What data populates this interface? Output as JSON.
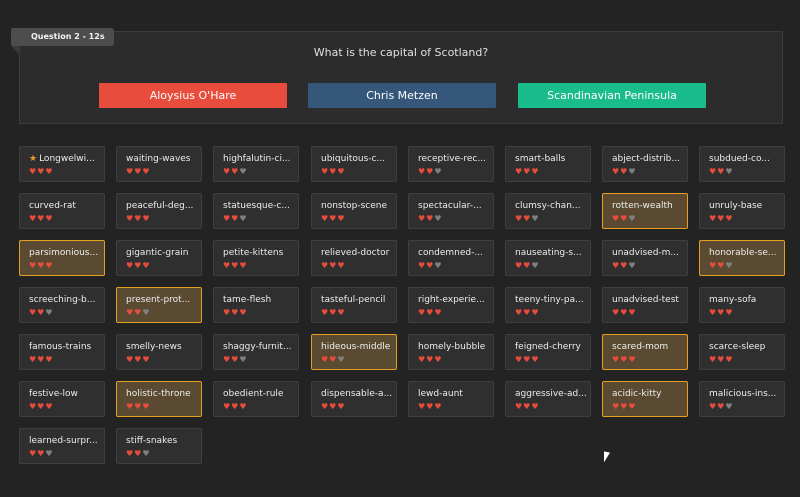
{
  "question": {
    "tag": "Question 2 - 12s",
    "text": "What is the capital of Scotland?",
    "answers": [
      "Aloysius O'Hare",
      "Chris Metzen",
      "Scandinavian Peninsula"
    ]
  },
  "colors": {
    "heart_full": "#e74c3c",
    "heart_empty": "#808080",
    "highlight": "#e5a021"
  },
  "players": [
    {
      "name": "Longwelwi...",
      "hearts": 3,
      "highlight": false,
      "star": true
    },
    {
      "name": "waiting-waves",
      "hearts": 3,
      "highlight": false
    },
    {
      "name": "highfalutin-ci...",
      "hearts": 2,
      "highlight": false
    },
    {
      "name": "ubiquitous-c...",
      "hearts": 3,
      "highlight": false
    },
    {
      "name": "receptive-rec...",
      "hearts": 2,
      "highlight": false
    },
    {
      "name": "smart-balls",
      "hearts": 3,
      "highlight": false
    },
    {
      "name": "abject-distrib...",
      "hearts": 2,
      "highlight": false
    },
    {
      "name": "subdued-co...",
      "hearts": 2,
      "highlight": false
    },
    {
      "name": "curved-rat",
      "hearts": 3,
      "highlight": false
    },
    {
      "name": "peaceful-deg...",
      "hearts": 3,
      "highlight": false
    },
    {
      "name": "statuesque-c...",
      "hearts": 2,
      "highlight": false
    },
    {
      "name": "nonstop-scene",
      "hearts": 3,
      "highlight": false
    },
    {
      "name": "spectacular-...",
      "hearts": 2,
      "highlight": false
    },
    {
      "name": "clumsy-chan...",
      "hearts": 2,
      "highlight": false
    },
    {
      "name": "rotten-wealth",
      "hearts": 2,
      "highlight": true
    },
    {
      "name": "unruly-base",
      "hearts": 3,
      "highlight": false
    },
    {
      "name": "parsimonious...",
      "hearts": 3,
      "highlight": true
    },
    {
      "name": "gigantic-grain",
      "hearts": 3,
      "highlight": false
    },
    {
      "name": "petite-kittens",
      "hearts": 3,
      "highlight": false
    },
    {
      "name": "relieved-doctor",
      "hearts": 3,
      "highlight": false
    },
    {
      "name": "condemned-...",
      "hearts": 2,
      "highlight": false
    },
    {
      "name": "nauseating-s...",
      "hearts": 2,
      "highlight": false
    },
    {
      "name": "unadvised-m...",
      "hearts": 2,
      "highlight": false
    },
    {
      "name": "honorable-se...",
      "hearts": 2,
      "highlight": true
    },
    {
      "name": "screeching-b...",
      "hearts": 2,
      "highlight": false
    },
    {
      "name": "present-prot...",
      "hearts": 2,
      "highlight": true
    },
    {
      "name": "tame-flesh",
      "hearts": 3,
      "highlight": false
    },
    {
      "name": "tasteful-pencil",
      "hearts": 3,
      "highlight": false
    },
    {
      "name": "right-experie...",
      "hearts": 3,
      "highlight": false
    },
    {
      "name": "teeny-tiny-pa...",
      "hearts": 3,
      "highlight": false
    },
    {
      "name": "unadvised-test",
      "hearts": 3,
      "highlight": false
    },
    {
      "name": "many-sofa",
      "hearts": 3,
      "highlight": false
    },
    {
      "name": "famous-trains",
      "hearts": 3,
      "highlight": false
    },
    {
      "name": "smelly-news",
      "hearts": 3,
      "highlight": false
    },
    {
      "name": "shaggy-furnit...",
      "hearts": 2,
      "highlight": false
    },
    {
      "name": "hideous-middle",
      "hearts": 2,
      "highlight": true
    },
    {
      "name": "homely-bubble",
      "hearts": 3,
      "highlight": false
    },
    {
      "name": "feigned-cherry",
      "hearts": 3,
      "highlight": false
    },
    {
      "name": "scared-mom",
      "hearts": 3,
      "highlight": true
    },
    {
      "name": "scarce-sleep",
      "hearts": 3,
      "highlight": false
    },
    {
      "name": "festive-low",
      "hearts": 3,
      "highlight": false
    },
    {
      "name": "holistic-throne",
      "hearts": 3,
      "highlight": true
    },
    {
      "name": "obedient-rule",
      "hearts": 3,
      "highlight": false
    },
    {
      "name": "dispensable-a...",
      "hearts": 3,
      "highlight": false
    },
    {
      "name": "lewd-aunt",
      "hearts": 3,
      "highlight": false
    },
    {
      "name": "aggressive-ad...",
      "hearts": 3,
      "highlight": false
    },
    {
      "name": "acidic-kitty",
      "hearts": 3,
      "highlight": true
    },
    {
      "name": "malicious-ins...",
      "hearts": 2,
      "highlight": false
    },
    {
      "name": "learned-surpr...",
      "hearts": 2,
      "highlight": false
    },
    {
      "name": "stiff-snakes",
      "hearts": 2,
      "highlight": false
    }
  ]
}
